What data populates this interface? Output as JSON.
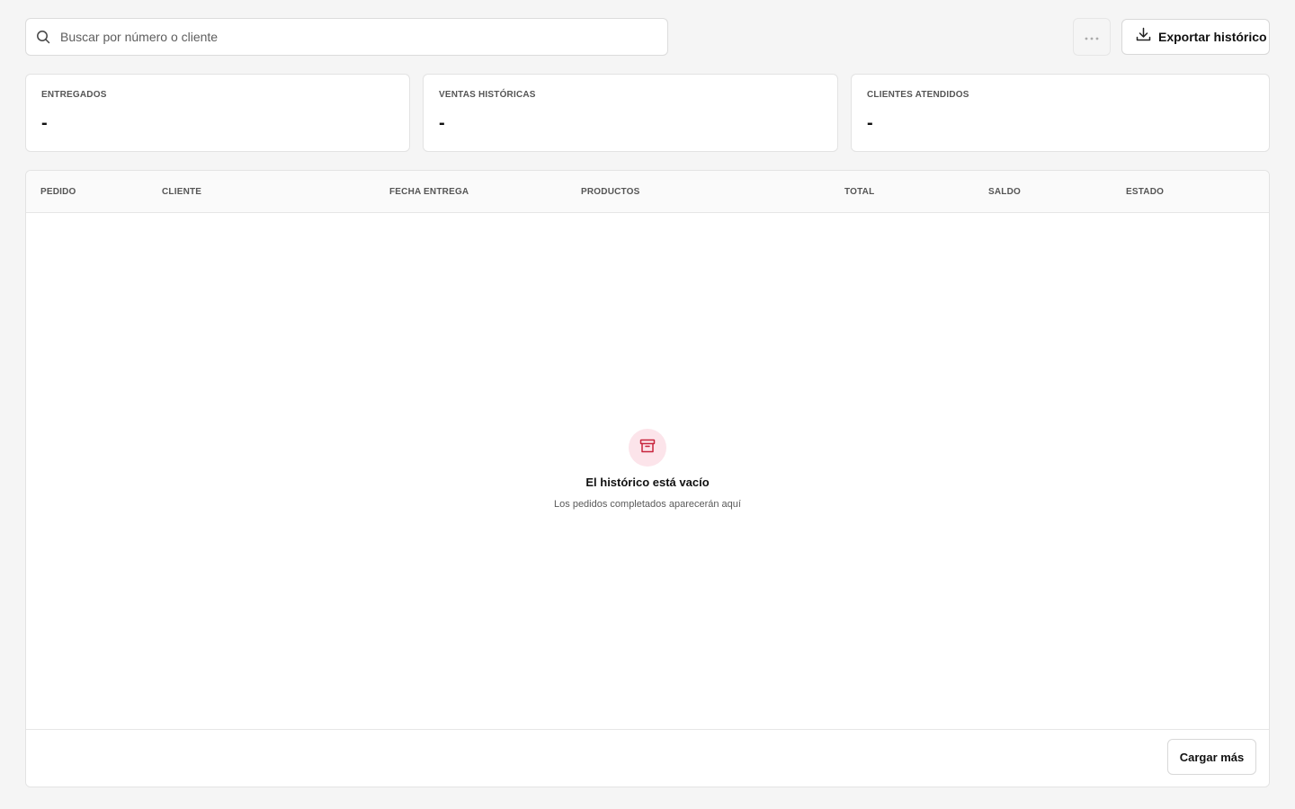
{
  "toolbar": {
    "search": {
      "placeholder": "Buscar por número o cliente",
      "value": "",
      "icon": "search-icon"
    },
    "more": {
      "icon": "more-horizontal-icon"
    },
    "export": {
      "label": "Exportar histórico",
      "icon": "download-icon"
    }
  },
  "stats": [
    {
      "label": "ENTREGADOS",
      "value": "-"
    },
    {
      "label": "VENTAS HISTÓRICAS",
      "value": "-"
    },
    {
      "label": "CLIENTES ATENDIDOS",
      "value": "-"
    }
  ],
  "table": {
    "columns": [
      "PEDIDO",
      "CLIENTE",
      "FECHA ENTREGA",
      "PRODUCTOS",
      "TOTAL",
      "SALDO",
      "ESTADO"
    ],
    "rows": [],
    "empty": {
      "icon": "archive-icon",
      "title": "El histórico está vacío",
      "subtitle": "Los pedidos completados aparecerán aquí"
    },
    "load_more_label": "Cargar más"
  },
  "colors": {
    "background": "#f5f5f5",
    "surface": "#ffffff",
    "accent": "#c8243d",
    "accent_soft": "#fce4ea"
  }
}
